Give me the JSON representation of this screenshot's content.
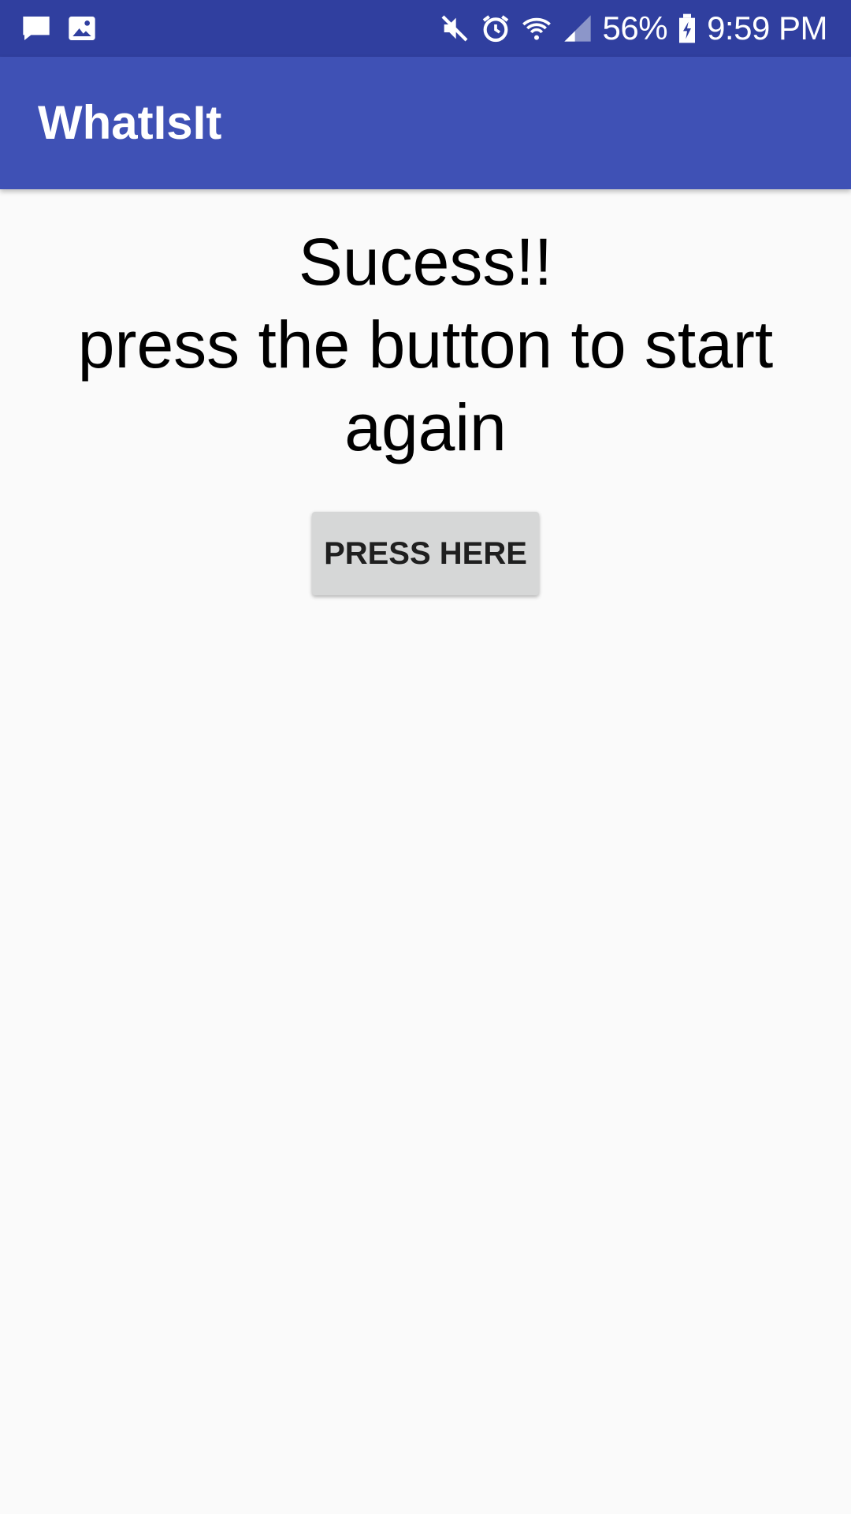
{
  "status_bar": {
    "battery_percent": "56%",
    "time": "9:59 PM",
    "left_icons": [
      "message-icon",
      "image-icon"
    ],
    "right_icons": [
      "mute-icon",
      "alarm-icon",
      "wifi-icon",
      "signal-icon",
      "battery-charging-icon"
    ],
    "color": "#303f9f"
  },
  "app_bar": {
    "title": "WhatIsIt",
    "color": "#3f51b5"
  },
  "main": {
    "message_lines": [
      "Sucess!!",
      "press the button to start",
      "again"
    ],
    "button_label": "PRESS HERE",
    "button_color": "#d6d7d7",
    "background": "#fafafa"
  }
}
